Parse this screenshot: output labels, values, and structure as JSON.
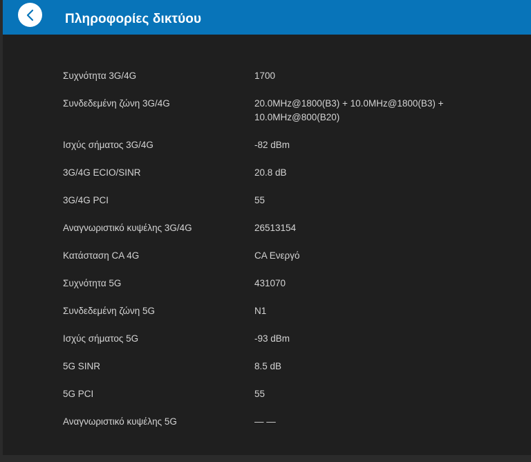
{
  "header": {
    "title": "Πληροφορίες δικτύου",
    "back_icon": "chevron-left-icon"
  },
  "colors": {
    "header_bg": "#0874b9",
    "content_bg": "#1f1f1f",
    "text": "#d4d4d4"
  },
  "rows": [
    {
      "label": "Συχνότητα 3G/4G",
      "value": "1700"
    },
    {
      "label": "Συνδεδεμένη ζώνη 3G/4G",
      "value": "20.0MHz@1800(B3) + 10.0MHz@1800(B3) + 10.0MHz@800(B20)"
    },
    {
      "label": "Ισχύς σήματος 3G/4G",
      "value": "-82 dBm"
    },
    {
      "label": "3G/4G ECIO/SINR",
      "value": "20.8 dB"
    },
    {
      "label": "3G/4G PCI",
      "value": "55"
    },
    {
      "label": "Αναγνωριστικό κυψέλης 3G/4G",
      "value": "26513154"
    },
    {
      "label": "Κατάσταση CA 4G",
      "value": "CA Ενεργό"
    },
    {
      "label": "Συχνότητα 5G",
      "value": "431070"
    },
    {
      "label": "Συνδεδεμένη ζώνη 5G",
      "value": "N1"
    },
    {
      "label": "Ισχύς σήματος 5G",
      "value": "-93 dBm"
    },
    {
      "label": "5G SINR",
      "value": "8.5 dB"
    },
    {
      "label": "5G PCI",
      "value": "55"
    },
    {
      "label": "Αναγνωριστικό κυψέλης 5G",
      "value": "— —"
    }
  ]
}
